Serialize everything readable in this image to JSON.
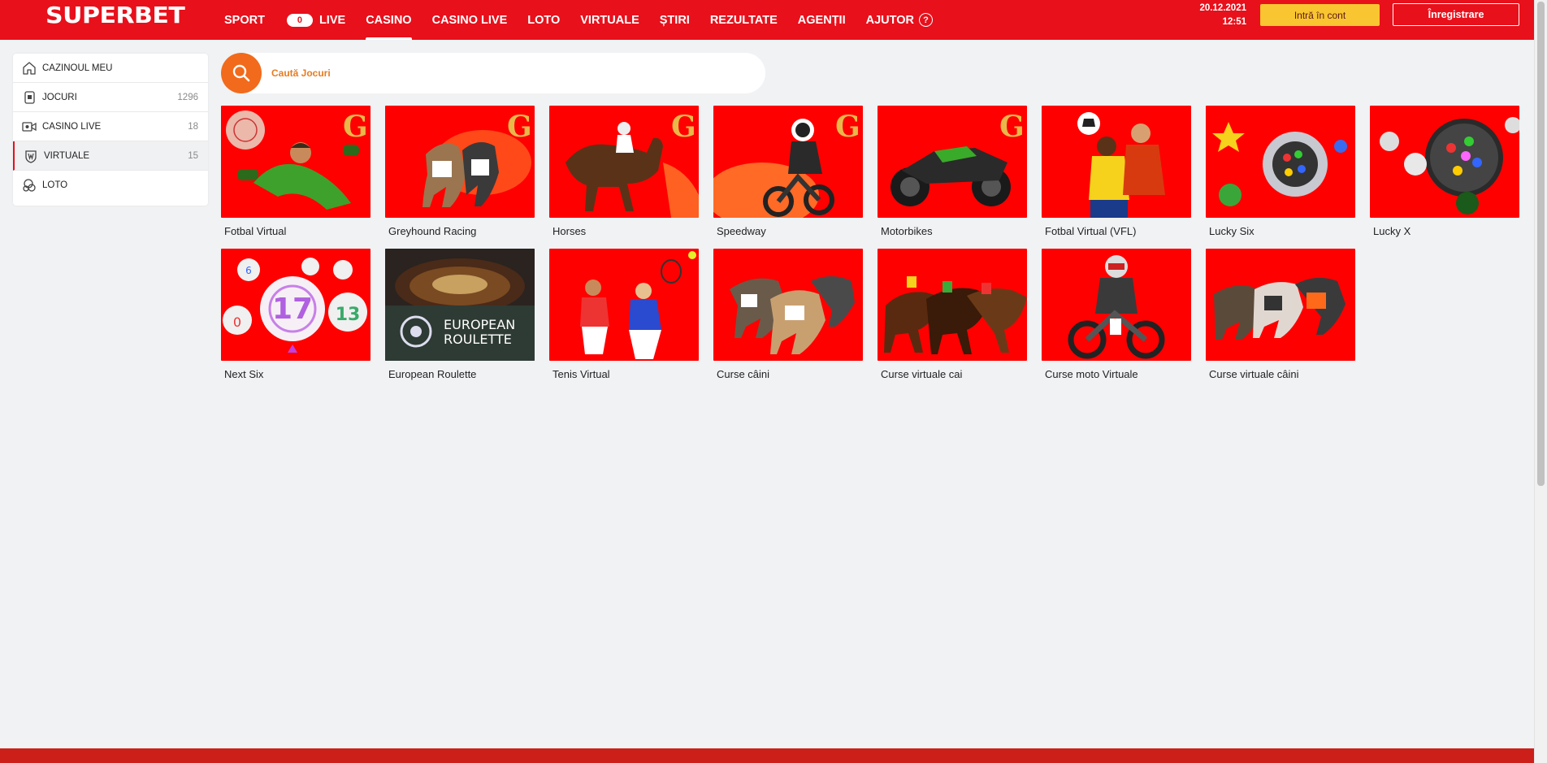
{
  "header": {
    "logo": "SUPERBET",
    "nav": [
      {
        "label": "SPORT"
      },
      {
        "label": "LIVE",
        "badge": "0"
      },
      {
        "label": "CASINO",
        "active": true
      },
      {
        "label": "CASINO LIVE"
      },
      {
        "label": "LOTO"
      },
      {
        "label": "VIRTUALE"
      },
      {
        "label": "ȘTIRI"
      },
      {
        "label": "REZULTATE"
      },
      {
        "label": "AGENȚII"
      },
      {
        "label": "AJUTOR",
        "icon": "help-icon"
      }
    ],
    "date": "20.12.2021",
    "time": "12:51",
    "login_label": "Intră în cont",
    "register_label": "Înregistrare"
  },
  "sidebar": {
    "items": [
      {
        "label": "CAZINOUL MEU",
        "icon": "home-icon",
        "count": ""
      },
      {
        "label": "JOCURI",
        "icon": "slot-icon",
        "count": "1296"
      },
      {
        "label": "CASINO LIVE",
        "icon": "live-camera-icon",
        "count": "18"
      },
      {
        "label": "VIRTUALE",
        "icon": "virtual-shield-icon",
        "count": "15",
        "active": true
      },
      {
        "label": "LOTO",
        "icon": "lottery-balls-icon",
        "count": ""
      }
    ]
  },
  "search": {
    "placeholder": "Caută Jocuri",
    "icon": "search-icon"
  },
  "games": [
    {
      "title": "Fotbal Virtual",
      "art": "goalkeeper",
      "g_badge": true
    },
    {
      "title": "Greyhound Racing",
      "art": "dogs",
      "g_badge": true
    },
    {
      "title": "Horses",
      "art": "horse",
      "g_badge": true
    },
    {
      "title": "Speedway",
      "art": "speedway",
      "g_badge": true
    },
    {
      "title": "Motorbikes",
      "art": "motorbike",
      "g_badge": true
    },
    {
      "title": "Fotbal Virtual (VFL)",
      "art": "footballers",
      "g_badge": false
    },
    {
      "title": "Lucky Six",
      "art": "lottery-machine",
      "g_badge": false
    },
    {
      "title": "Lucky X",
      "art": "lottery-globe",
      "g_badge": false
    },
    {
      "title": "Next Six",
      "art": "balls",
      "g_badge": false,
      "ball_numbers": [
        "17",
        "13",
        "0",
        "6"
      ]
    },
    {
      "title": "European Roulette",
      "art": "roulette",
      "g_badge": false,
      "logo_line1": "EUROPEAN",
      "logo_line2": "ROULETTE"
    },
    {
      "title": "Tenis Virtual",
      "art": "tennis",
      "g_badge": false
    },
    {
      "title": "Curse câini",
      "art": "dogs2",
      "g_badge": false
    },
    {
      "title": "Curse virtuale cai",
      "art": "horses2",
      "g_badge": false
    },
    {
      "title": "Curse moto Virtuale",
      "art": "moto-rider",
      "g_badge": false
    },
    {
      "title": "Curse virtuale câini",
      "art": "dogs3",
      "g_badge": false
    }
  ],
  "colors": {
    "brand_red": "#e8101b",
    "search_orange": "#f26a1b",
    "login_yellow": "#f9c531",
    "thumb_red": "#ff0000"
  }
}
